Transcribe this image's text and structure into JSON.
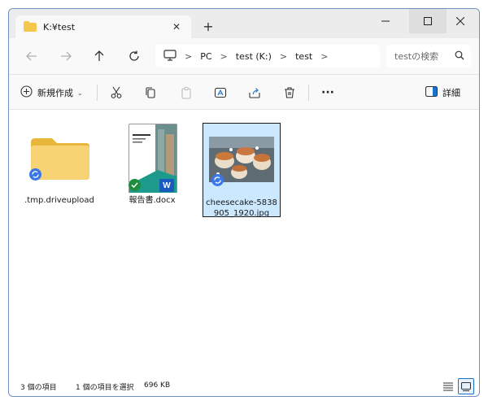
{
  "window": {
    "tab_title": "K:¥test",
    "tab_close": "✕",
    "new_tab": "+"
  },
  "navigation": {
    "breadcrumb": [
      "PC",
      "test (K:)",
      "test"
    ],
    "search_placeholder": "testの検索"
  },
  "toolbar": {
    "new_label": "新規作成",
    "details_label": "詳細",
    "more_label": "···"
  },
  "files": [
    {
      "name": ".tmp.driveupload",
      "type": "folder",
      "sync_status": "syncing"
    },
    {
      "name": "報告書.docx",
      "type": "word-document",
      "sync_status": "synced"
    },
    {
      "name": "cheesecake-5838905_1920.jpg",
      "type": "image",
      "sync_status": "syncing",
      "selected": true
    }
  ],
  "status": {
    "item_count": "3 個の項目",
    "selection": "1 個の項目を選択",
    "size": "696 KB"
  },
  "colors": {
    "accent": "#1a73c8",
    "folder": "#f5c84c",
    "selected_bg": "#cce8ff",
    "word_blue": "#185abd",
    "synced_green": "#1e8e3e",
    "sync_blue": "#3b78e7"
  }
}
